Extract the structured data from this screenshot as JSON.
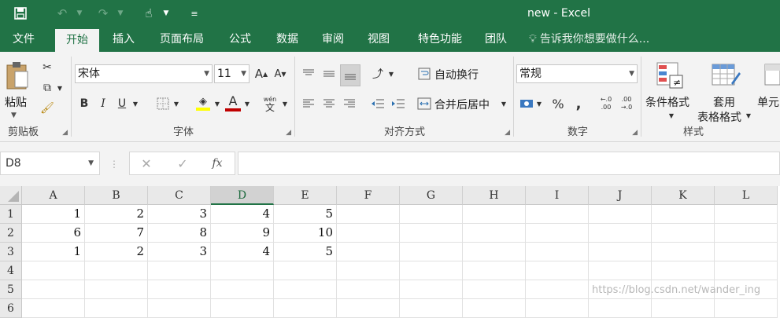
{
  "window": {
    "title": "new - Excel"
  },
  "qat": {
    "save_icon": "save-icon",
    "undo_icon": "undo-icon",
    "redo_icon": "redo-icon",
    "touch_icon": "touch-mode-icon",
    "customize_icon": "customize-icon"
  },
  "tabs": [
    "文件",
    "开始",
    "插入",
    "页面布局",
    "公式",
    "数据",
    "审阅",
    "视图",
    "特色功能",
    "团队"
  ],
  "tell_me": "告诉我你想要做什么...",
  "ribbon": {
    "clipboard": {
      "paste": "粘贴",
      "label": "剪贴板"
    },
    "font": {
      "name": "宋体",
      "size": "11",
      "label": "字体",
      "bold": "B",
      "italic": "I",
      "underline": "U",
      "grow": "A",
      "shrink": "A",
      "phonetic_top": "wén",
      "phonetic_bottom": "文",
      "font_color": "A"
    },
    "alignment": {
      "wrap": "自动换行",
      "merge": "合并后居中",
      "label": "对齐方式"
    },
    "number": {
      "format": "常规",
      "percent": "%",
      "comma": ",",
      "inc_decimal": "←.0 .00",
      "dec_decimal": ".00 →.0",
      "label": "数字"
    },
    "styles": {
      "conditional": "条件格式",
      "table_line1": "套用",
      "table_line2": "表格格式",
      "cell": "单元",
      "label": "样式"
    }
  },
  "formula_bar": {
    "name_box": "D8",
    "cancel": "✕",
    "enter": "✓",
    "fx": "fx",
    "formula": ""
  },
  "sheet": {
    "columns": [
      "A",
      "B",
      "C",
      "D",
      "E",
      "F",
      "G",
      "H",
      "I",
      "J",
      "K",
      "L"
    ],
    "selected_column": "D",
    "rows": [
      {
        "header": "1",
        "cells": [
          "1",
          "2",
          "3",
          "4",
          "5",
          "",
          "",
          "",
          "",
          "",
          "",
          ""
        ]
      },
      {
        "header": "2",
        "cells": [
          "6",
          "7",
          "8",
          "9",
          "10",
          "",
          "",
          "",
          "",
          "",
          "",
          ""
        ]
      },
      {
        "header": "3",
        "cells": [
          "1",
          "2",
          "3",
          "4",
          "5",
          "",
          "",
          "",
          "",
          "",
          "",
          ""
        ]
      },
      {
        "header": "4",
        "cells": [
          "",
          "",
          "",
          "",
          "",
          "",
          "",
          "",
          "",
          "",
          "",
          ""
        ]
      },
      {
        "header": "5",
        "cells": [
          "",
          "",
          "",
          "",
          "",
          "",
          "",
          "",
          "",
          "",
          "",
          ""
        ]
      },
      {
        "header": "6",
        "cells": [
          "",
          "",
          "",
          "",
          "",
          "",
          "",
          "",
          "",
          "",
          "",
          ""
        ]
      }
    ]
  },
  "watermark": "https://blog.csdn.net/wander_ing",
  "colors": {
    "accent": "#217346",
    "font_color": "#c00000",
    "highlight": "#ffff00"
  }
}
